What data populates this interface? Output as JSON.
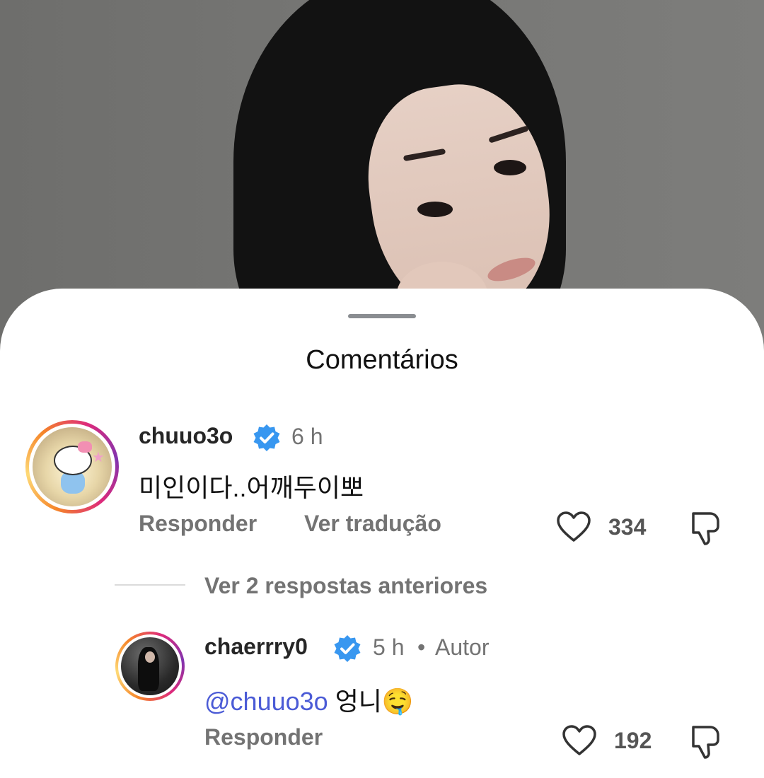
{
  "sheet": {
    "title": "Comentários"
  },
  "comments": [
    {
      "username": "chuuo3o",
      "time": "6 h",
      "text": "미인이다..어깨두이뽀",
      "actions": {
        "reply": "Responder",
        "translate": "Ver tradução"
      },
      "likes": "334"
    }
  ],
  "view_replies": "Ver 2 respostas anteriores",
  "reply": {
    "username": "chaerrry0",
    "time": "5 h",
    "separator": "•",
    "author_label": "Autor",
    "mention": "@chuuo3o",
    "text": " 엉니🤤",
    "actions": {
      "reply": "Responder"
    },
    "likes": "192"
  },
  "icons": {
    "verified": "verified-badge-icon",
    "like": "heart-icon",
    "dislike": "thumbs-down-icon"
  },
  "colors": {
    "verified": "#3897f0",
    "mention": "#4b5bd6"
  }
}
